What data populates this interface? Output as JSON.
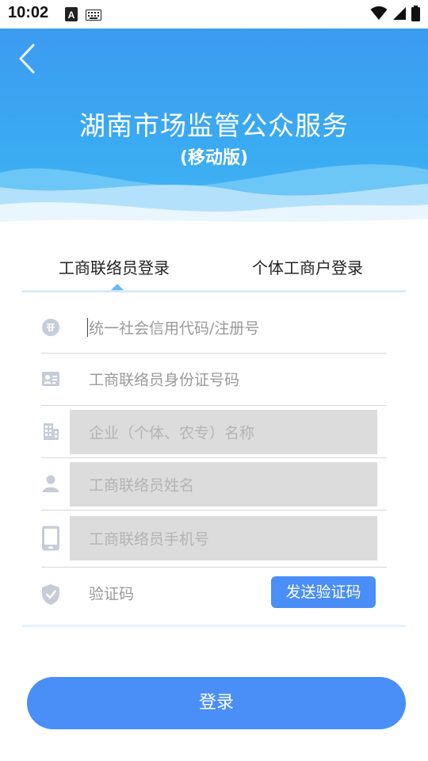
{
  "status_bar": {
    "time": "10:02",
    "left_icons": [
      "font-a-icon",
      "keyboard-icon"
    ],
    "right_icons": [
      "wifi-icon",
      "signal-icon",
      "battery-icon"
    ]
  },
  "header": {
    "title": "湖南市场监管公众服务",
    "subtitle": "(移动版)",
    "back_icon": "chevron-left-icon"
  },
  "tabs": [
    {
      "label": "工商联络员登录",
      "active": true
    },
    {
      "label": "个体工商户登录",
      "active": false
    }
  ],
  "form": {
    "fields": [
      {
        "icon": "id-code-icon",
        "placeholder": "统一社会信用代码/注册号",
        "enabled": true
      },
      {
        "icon": "id-card-icon",
        "placeholder": "工商联络员身份证号码",
        "enabled": true
      },
      {
        "icon": "building-icon",
        "placeholder": "企业（个体、农专）名称",
        "enabled": false
      },
      {
        "icon": "person-icon",
        "placeholder": "工商联络员姓名",
        "enabled": false
      },
      {
        "icon": "phone-icon",
        "placeholder": "工商联络员手机号",
        "enabled": false
      },
      {
        "icon": "shield-check-icon",
        "placeholder": "验证码",
        "enabled": true
      }
    ],
    "send_code_label": "发送验证码"
  },
  "login_label": "登录",
  "colors": {
    "primary": "#4a8ef7",
    "header_blue": "#3aaaf2",
    "disabled_bg": "#dcdcdc",
    "icon_gray": "#c6ccd8"
  }
}
